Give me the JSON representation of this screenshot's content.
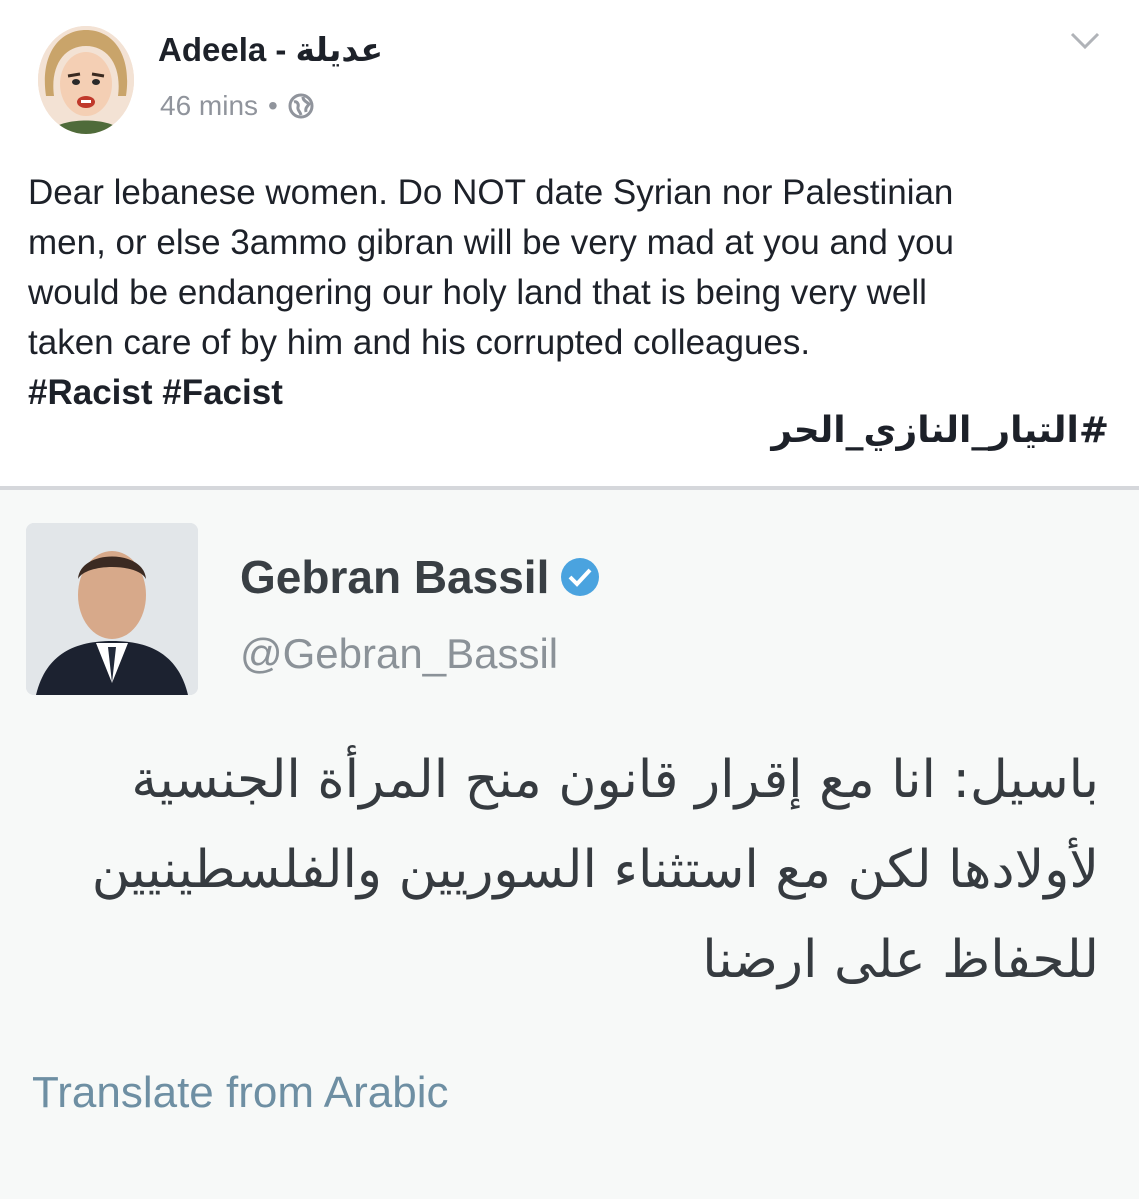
{
  "post": {
    "author": "Adeela - عديلة",
    "time": "46 mins",
    "separator": "•",
    "body_lines": [
      "Dear lebanese women. Do NOT date Syrian nor Palestinian",
      "men, or else 3ammo gibran will be very mad at you and  you",
      "would  be endangering our holy land that is being very well",
      "taken care of by him and his corrupted colleagues."
    ],
    "hashtags": "#Racist #Facist",
    "arabic_hashtag": "#التيار_النازي_الحر",
    "icons": {
      "privacy": "globe-icon",
      "menu": "chevron-down-icon"
    }
  },
  "tweet": {
    "name": "Gebran Bassil",
    "handle": "@Gebran_Bassil",
    "body_lines": [
      "باسيل: انا مع إقرار قانون منح المرأة الجنسية",
      "لأولادها لكن مع استثناء السوريين والفلسطينيين",
      "للحفاظ على ارضنا"
    ],
    "translate_label": "Translate from Arabic",
    "icons": {
      "verified": "verified-badge-icon"
    },
    "colors": {
      "verified": "#4aa3df",
      "translate": "#6e8fa3"
    }
  }
}
